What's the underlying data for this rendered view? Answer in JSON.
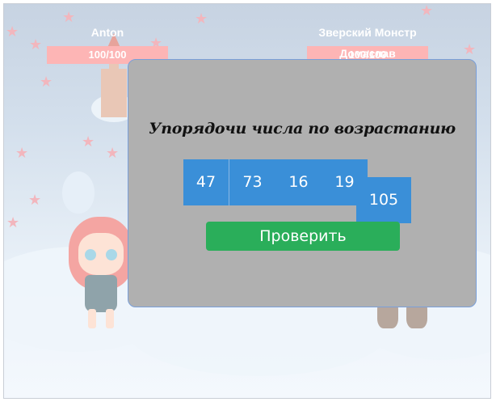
{
  "players": [
    {
      "name": "Anton",
      "hp": "100/100"
    },
    {
      "name": "Зверский Монстр Домаслав",
      "hp": "100/100"
    }
  ],
  "puzzle": {
    "title": "Упорядочи числа по возрастанию",
    "numbers": [
      "47",
      "73",
      "16",
      "19",
      "105"
    ],
    "check_label": "Проверить"
  },
  "colors": {
    "tile": "#3a8fd8",
    "button": "#2aae5a",
    "modal": "#b0b0b0",
    "hp_bar": "#fdb5b5"
  }
}
